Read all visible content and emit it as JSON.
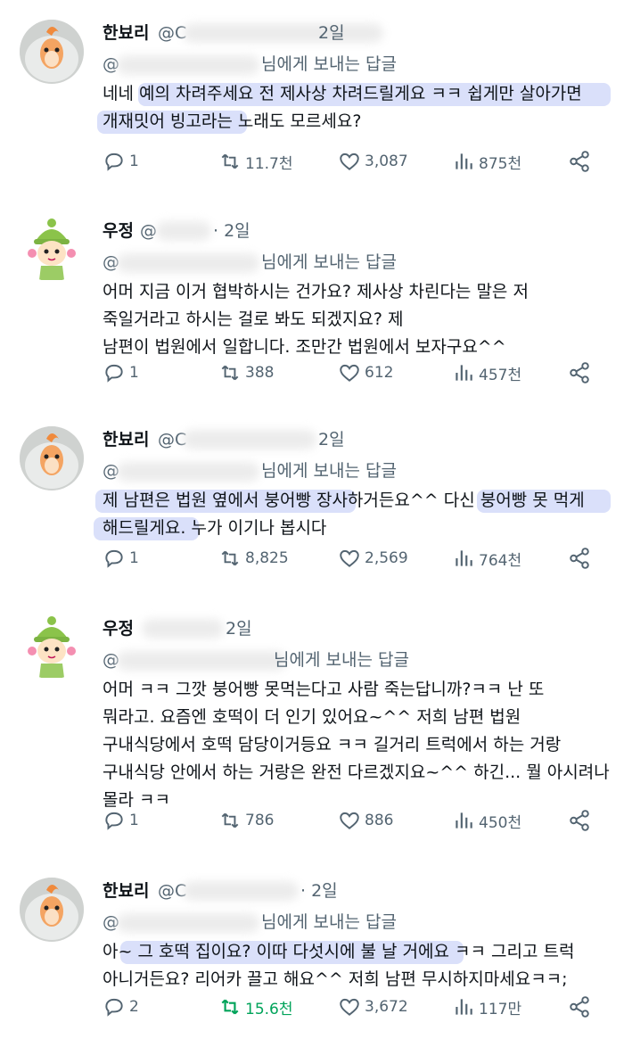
{
  "posts": [
    {
      "author": "한뵤리",
      "handle_prefix": "@C",
      "time": "2일",
      "reply_prefix": "@",
      "reply_text": "님에게 보내는 답글",
      "lines": [
        "네네 예의 차려주세요 전 제사상 차려드릴게요 ㅋㅋ 쉽게만 살아가면",
        "개재밋어 빙고라는 노래도 모르세요?"
      ],
      "replies": "1",
      "reposts": "11.7천",
      "likes": "3,087",
      "views": "875천"
    },
    {
      "author": "우정",
      "handle_prefix": "@",
      "time": "· 2일",
      "reply_prefix": "@",
      "reply_text": "님에게 보내는 답글",
      "lines": [
        "어머 지금 이거 협박하시는 건가요? 제사상 차린다는 말은 저",
        "죽일거라고 하시는 걸로 봐도 되겠지요? 제",
        "남편이 법원에서 일합니다. 조만간 법원에서 보자구요^^"
      ],
      "replies": "1",
      "reposts": "388",
      "likes": "612",
      "views": "457천"
    },
    {
      "author": "한뵤리",
      "handle_prefix": "@C",
      "time": "2일",
      "reply_prefix": "@",
      "reply_text": "님에게 보내는 답글",
      "lines": [
        "제 남편은 법원 옆에서 붕어빵 장사하거든요^^ 다신 붕어빵 못 먹게",
        "해드릴게요. 누가 이기나 봅시다"
      ],
      "replies": "1",
      "reposts": "8,825",
      "likes": "2,569",
      "views": "764천"
    },
    {
      "author": "우정",
      "handle_prefix": "",
      "time": "2일",
      "reply_prefix": "@",
      "reply_text": "님에게 보내는 답글",
      "lines": [
        "어머 ㅋㅋ 그깟 붕어빵 못먹는다고 사람 죽는답니까?ㅋㅋ 난 또",
        "뭐라고. 요즘엔 호떡이 더 인기 있어요~^^ 저희 남편 법원",
        "구내식당에서 호떡 담당이거등요 ㅋㅋ 길거리 트럭에서 하는 거랑",
        "구내식당 안에서 하는 거랑은 완전 다르겠지요~^^ 하긴... 뭘 아시려나",
        "몰라 ㅋㅋ"
      ],
      "replies": "1",
      "reposts": "786",
      "likes": "886",
      "views": "450천"
    },
    {
      "author": "한뵤리",
      "handle_prefix": "@C",
      "time": "· 2일",
      "reply_prefix": "@",
      "reply_text": "님에게 보내는 답글",
      "lines": [
        "아~ 그 호떡 집이요? 이따 다섯시에 불 날 거에요 ㅋㅋ 그리고 트럭",
        "아니거든요? 리어카 끌고 해요^^ 저희 남편 무시하지마세요ㅋㅋ;"
      ],
      "replies": "2",
      "reposts": "15.6천",
      "likes": "3,672",
      "views": "117만"
    }
  ],
  "colors": {
    "text": "#0f1419",
    "muted": "#536471",
    "repost_active": "#00a35a",
    "highlight": "#96a5f0"
  },
  "icons": [
    "reply-icon",
    "repost-icon",
    "like-icon",
    "views-icon",
    "share-icon",
    "more-icon",
    "goldfish-avatar",
    "character-avatar"
  ]
}
